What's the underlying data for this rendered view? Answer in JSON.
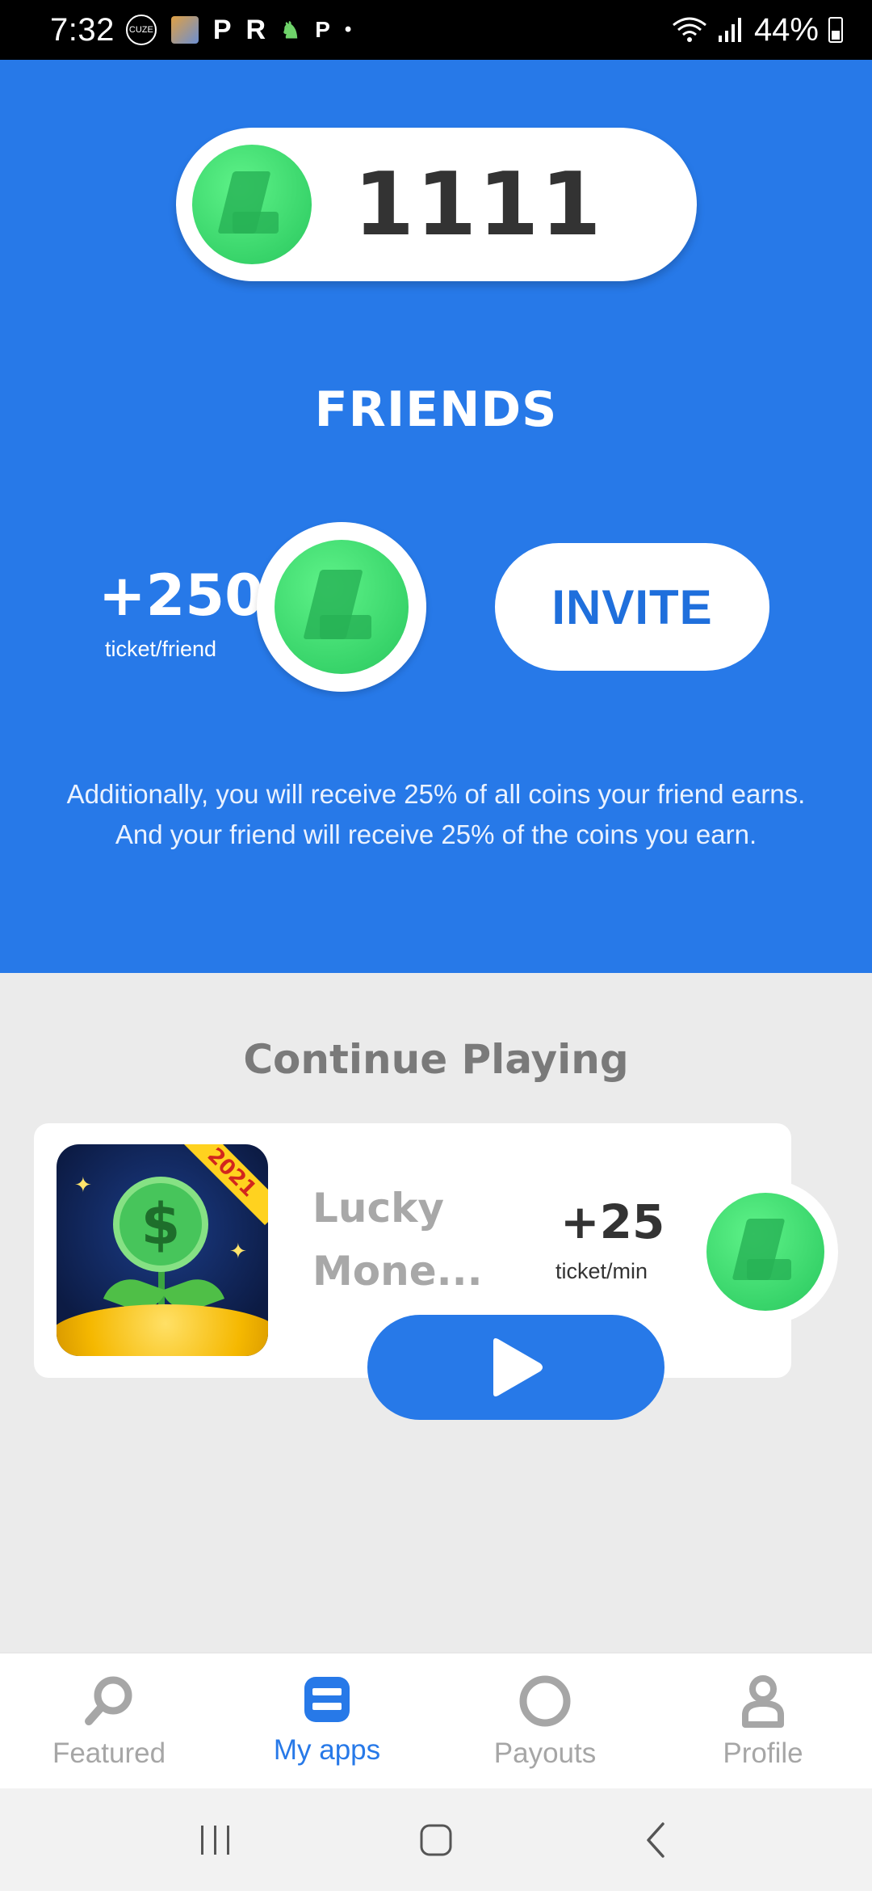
{
  "status_bar": {
    "time": "7:32",
    "left_icons": [
      "CUZE",
      "P",
      "R",
      "P",
      "•"
    ],
    "battery": "44%"
  },
  "balance": {
    "value": "1111"
  },
  "friends": {
    "title": "FRIENDS",
    "bonus_amount": "+250",
    "bonus_unit": "ticket/friend",
    "invite_label": "INVITE",
    "note": "Additionally, you will receive 25% of all coins your friend earns. And your friend will receive 25% of the coins you earn."
  },
  "continue_playing": {
    "title": "Continue Playing",
    "game": {
      "name": "Lucky Mone...",
      "icon_badge": "2021",
      "icon_symbol": "$",
      "reward": "+25",
      "reward_unit": "ticket/min"
    }
  },
  "bottom_nav": {
    "items": [
      {
        "label": "Featured",
        "icon": "search-icon",
        "active": false
      },
      {
        "label": "My apps",
        "icon": "apps-icon",
        "active": true
      },
      {
        "label": "Payouts",
        "icon": "payouts-icon",
        "active": false
      },
      {
        "label": "Profile",
        "icon": "profile-icon",
        "active": false
      }
    ]
  },
  "colors": {
    "brand_blue": "#2779e8",
    "coin_green": "#38d46a",
    "page_bg": "#ebebeb",
    "nav_inactive": "#a6a6a6"
  }
}
